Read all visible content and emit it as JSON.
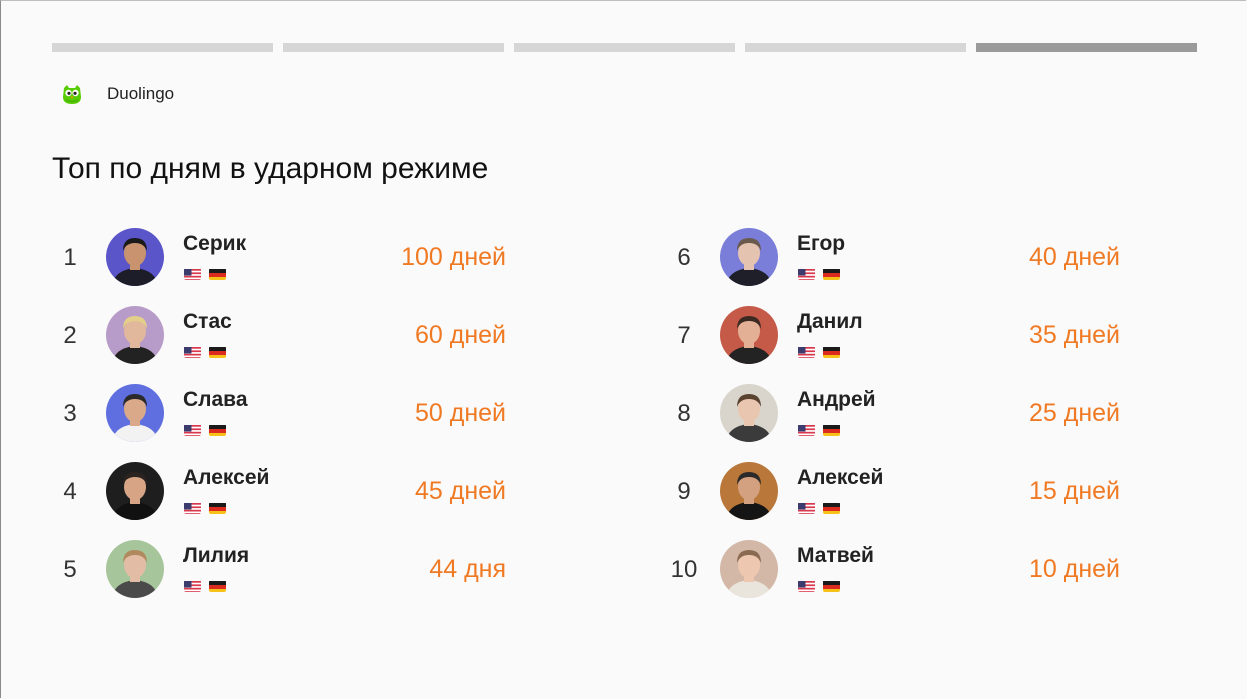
{
  "brand": {
    "name": "Duolingo",
    "logo_icon": "duolingo-owl-icon",
    "logo_color": "#58cc02"
  },
  "progress": {
    "segments": 5,
    "active_index": 4
  },
  "title": "Топ по дням в ударном режиме",
  "colors": {
    "accent": "#f07a24",
    "segment": "#d6d6d6",
    "segment_active": "#9a9a9a"
  },
  "leaderboard": [
    {
      "rank": "1",
      "name": "Серик",
      "days": "100 дней",
      "flags": [
        "us-flag-icon",
        "de-flag-icon"
      ],
      "avatar_bg": "#5a55c8",
      "avatar_skin": "#c9936f",
      "avatar_hair": "#1a1a1a",
      "avatar_shirt": "#1d1d2a"
    },
    {
      "rank": "2",
      "name": "Стас",
      "days": "60 дней",
      "flags": [
        "us-flag-icon",
        "de-flag-icon"
      ],
      "avatar_bg": "#b79cc9",
      "avatar_skin": "#e2b89c",
      "avatar_hair": "#e3cf8a",
      "avatar_shirt": "#222"
    },
    {
      "rank": "3",
      "name": "Слава",
      "days": "50 дней",
      "flags": [
        "us-flag-icon",
        "de-flag-icon"
      ],
      "avatar_bg": "#5f6fe0",
      "avatar_skin": "#d9a98a",
      "avatar_hair": "#2a2a2a",
      "avatar_shirt": "#f2f2f2"
    },
    {
      "rank": "4",
      "name": "Алексей",
      "days": "45 дней",
      "flags": [
        "us-flag-icon",
        "de-flag-icon"
      ],
      "avatar_bg": "#1e1e1e",
      "avatar_skin": "#d7a586",
      "avatar_hair": "#2b2320",
      "avatar_shirt": "#111"
    },
    {
      "rank": "5",
      "name": "Лилия",
      "days": "44 дня",
      "flags": [
        "us-flag-icon",
        "de-flag-icon"
      ],
      "avatar_bg": "#a7c59a",
      "avatar_skin": "#e2bca4",
      "avatar_hair": "#b08a5e",
      "avatar_shirt": "#4a4a4a"
    },
    {
      "rank": "6",
      "name": "Егор",
      "days": "40 дней",
      "flags": [
        "us-flag-icon",
        "de-flag-icon"
      ],
      "avatar_bg": "#7a7ed8",
      "avatar_skin": "#e4c3b0",
      "avatar_hair": "#6a5a4e",
      "avatar_shirt": "#1f1f2a"
    },
    {
      "rank": "7",
      "name": "Данил",
      "days": "35 дней",
      "flags": [
        "us-flag-icon",
        "de-flag-icon"
      ],
      "avatar_bg": "#c55a48",
      "avatar_skin": "#e3b096",
      "avatar_hair": "#3b2a22",
      "avatar_shirt": "#232323"
    },
    {
      "rank": "8",
      "name": "Андрей",
      "days": "25 дней",
      "flags": [
        "us-flag-icon",
        "de-flag-icon"
      ],
      "avatar_bg": "#d9d5cc",
      "avatar_skin": "#e8c6b0",
      "avatar_hair": "#5b4332",
      "avatar_shirt": "#3b3b3b"
    },
    {
      "rank": "9",
      "name": "Алексей",
      "days": "15 дней",
      "flags": [
        "us-flag-icon",
        "de-flag-icon"
      ],
      "avatar_bg": "#b9783a",
      "avatar_skin": "#d3a080",
      "avatar_hair": "#2a2a2a",
      "avatar_shirt": "#151515"
    },
    {
      "rank": "10",
      "name": "Матвей",
      "days": "10 дней",
      "flags": [
        "us-flag-icon",
        "de-flag-icon"
      ],
      "avatar_bg": "#d3b8a8",
      "avatar_skin": "#edc7b0",
      "avatar_hair": "#8a6a50",
      "avatar_shirt": "#e9e4dc"
    }
  ]
}
